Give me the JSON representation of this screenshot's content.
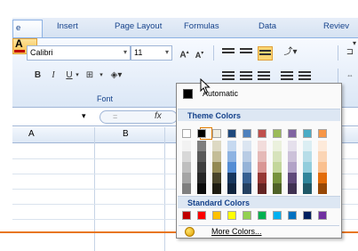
{
  "tabs": [
    {
      "label": "e"
    },
    {
      "label": "Insert"
    },
    {
      "label": "Page Layout"
    },
    {
      "label": "Formulas"
    },
    {
      "label": "Data"
    },
    {
      "label": "Reviev"
    }
  ],
  "ribbon": {
    "font_name": "Calibri",
    "font_size": "11",
    "grow_label": "A",
    "shrink_label": "A",
    "bold_label": "B",
    "italic_label": "I",
    "underline_label": "U",
    "font_color_label": "A",
    "group_label": "Font"
  },
  "formula_bar": {
    "fx_label": "fx"
  },
  "columns": [
    "A",
    "B"
  ],
  "color_menu": {
    "automatic_label": "Automatic",
    "theme_header": "Theme Colors",
    "standard_header": "Standard Colors",
    "more_label": "More Colors...",
    "selected_color": "#000000",
    "theme_top": [
      "#ffffff",
      "#000000",
      "#eeece1",
      "#1f497d",
      "#4f81bd",
      "#c0504d",
      "#9bbb59",
      "#8064a2",
      "#4bacc6",
      "#f79646"
    ],
    "theme_shades": [
      [
        "#f2f2f2",
        "#d8d8d8",
        "#bfbfbf",
        "#a5a5a5",
        "#7f7f7f"
      ],
      [
        "#7f7f7f",
        "#595959",
        "#3f3f3f",
        "#262626",
        "#0c0c0c"
      ],
      [
        "#ddd9c3",
        "#c4bd97",
        "#938953",
        "#494429",
        "#1d1b10"
      ],
      [
        "#c6d9f0",
        "#8db3e2",
        "#548dd4",
        "#17365d",
        "#0f243e"
      ],
      [
        "#dbe5f1",
        "#b8cce4",
        "#95b3d7",
        "#366092",
        "#244061"
      ],
      [
        "#f2dcdb",
        "#e5b9b7",
        "#d99694",
        "#953734",
        "#632423"
      ],
      [
        "#ebf1dd",
        "#d7e3bc",
        "#c3d69b",
        "#76923c",
        "#4f6128"
      ],
      [
        "#e5e0ec",
        "#ccc1d9",
        "#b2a2c7",
        "#5f497a",
        "#3f3151"
      ],
      [
        "#dbeef3",
        "#b7dde8",
        "#92cddc",
        "#31859b",
        "#205867"
      ],
      [
        "#fdeada",
        "#fbd5b5",
        "#fac08f",
        "#e36c09",
        "#974806"
      ]
    ],
    "standard": [
      "#c00000",
      "#ff0000",
      "#ffc000",
      "#ffff00",
      "#92d050",
      "#00b050",
      "#00b0f0",
      "#0070c0",
      "#002060",
      "#7030a0"
    ]
  }
}
